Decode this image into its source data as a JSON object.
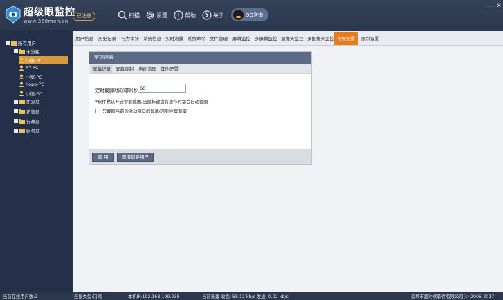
{
  "app": {
    "brand": "超级眼监控",
    "url": "www.360mon.cn",
    "registered_badge": "已注册"
  },
  "toolbar": {
    "scan_label": "扫描",
    "settings_label": "设置",
    "help_label": "帮助",
    "about_label": "关于",
    "qq_label": "QQ咨询"
  },
  "tabs": [
    "用户信息",
    "历史记录",
    "行为审计",
    "系统信息",
    "实时流量",
    "系统命令",
    "文件管理",
    "屏幕监控",
    "多屏幕监控",
    "摄像头监控",
    "多摄像头监控",
    "常规设置",
    "限制设置"
  ],
  "active_tab": "常规设置",
  "sidebar": {
    "root": "所有用户",
    "ungrouped": "未分组",
    "users": [
      "小张-PC",
      "XY-PC",
      "小宽-PC",
      "hopo-PC",
      "小恒-PC"
    ],
    "selected_user": "小张-PC",
    "departments": [
      "研发部",
      "销售部",
      "行政部",
      "财务部"
    ]
  },
  "panel": {
    "title": "常规设置",
    "subtabs": [
      "屏幕记录",
      "屏幕录制",
      "自动清理",
      "其他配置"
    ],
    "active_subtab": "屏幕记录",
    "interval_label": "定时截屏时间间隔(秒):",
    "interval_value": "60",
    "hint": "*软件默认开启智能截图,当鼠标键盘有操作时都会自动截图",
    "checkbox_label": "只截取当前的活动窗口的屏幕(否则全屏截取)",
    "checkbox_checked": false,
    "apply_button": "应 用",
    "apply_multi_button": "应用到多用户"
  },
  "status": {
    "online_users": "当前在线用户数:2",
    "connection_type": "连接类型:内网",
    "local_ip": "本机IP:192.168.199.238",
    "traffic": "当前流量 收到: 58.12 kb/s   发送: 0.02 kb/s",
    "copyright": "深圳市超时代软件有限公司(c) 2005-2017"
  },
  "colors": {
    "accent": "#e57b19",
    "panel_header": "#5d6a85",
    "sidebar_bg": "#24304a",
    "selected_item": "#d89a3c"
  }
}
